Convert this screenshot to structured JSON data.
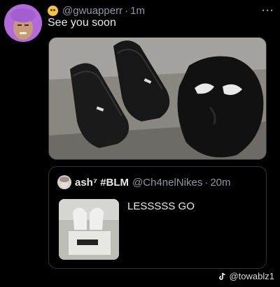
{
  "tweet": {
    "handle": "@gwuapperr",
    "separator": "·",
    "time": "1m",
    "text": "See you soon",
    "more": "···"
  },
  "quoted": {
    "name": "ash⁷ #BLM",
    "handle": "@Ch4nelNikes",
    "separator": "·",
    "time": "20m",
    "text": "LESSSSS GO"
  },
  "watermark": {
    "text": "@towablz1"
  },
  "icons": {
    "emoji": "astonished-emoji-icon",
    "more": "more-options-icon",
    "watermark": "tiktok-logo-icon"
  },
  "colors": {
    "background": "#000000",
    "text_primary": "#e7e9ea",
    "text_secondary": "#8b98a5",
    "border": "#2f3336",
    "avatar_bg": "#b46ad8"
  }
}
